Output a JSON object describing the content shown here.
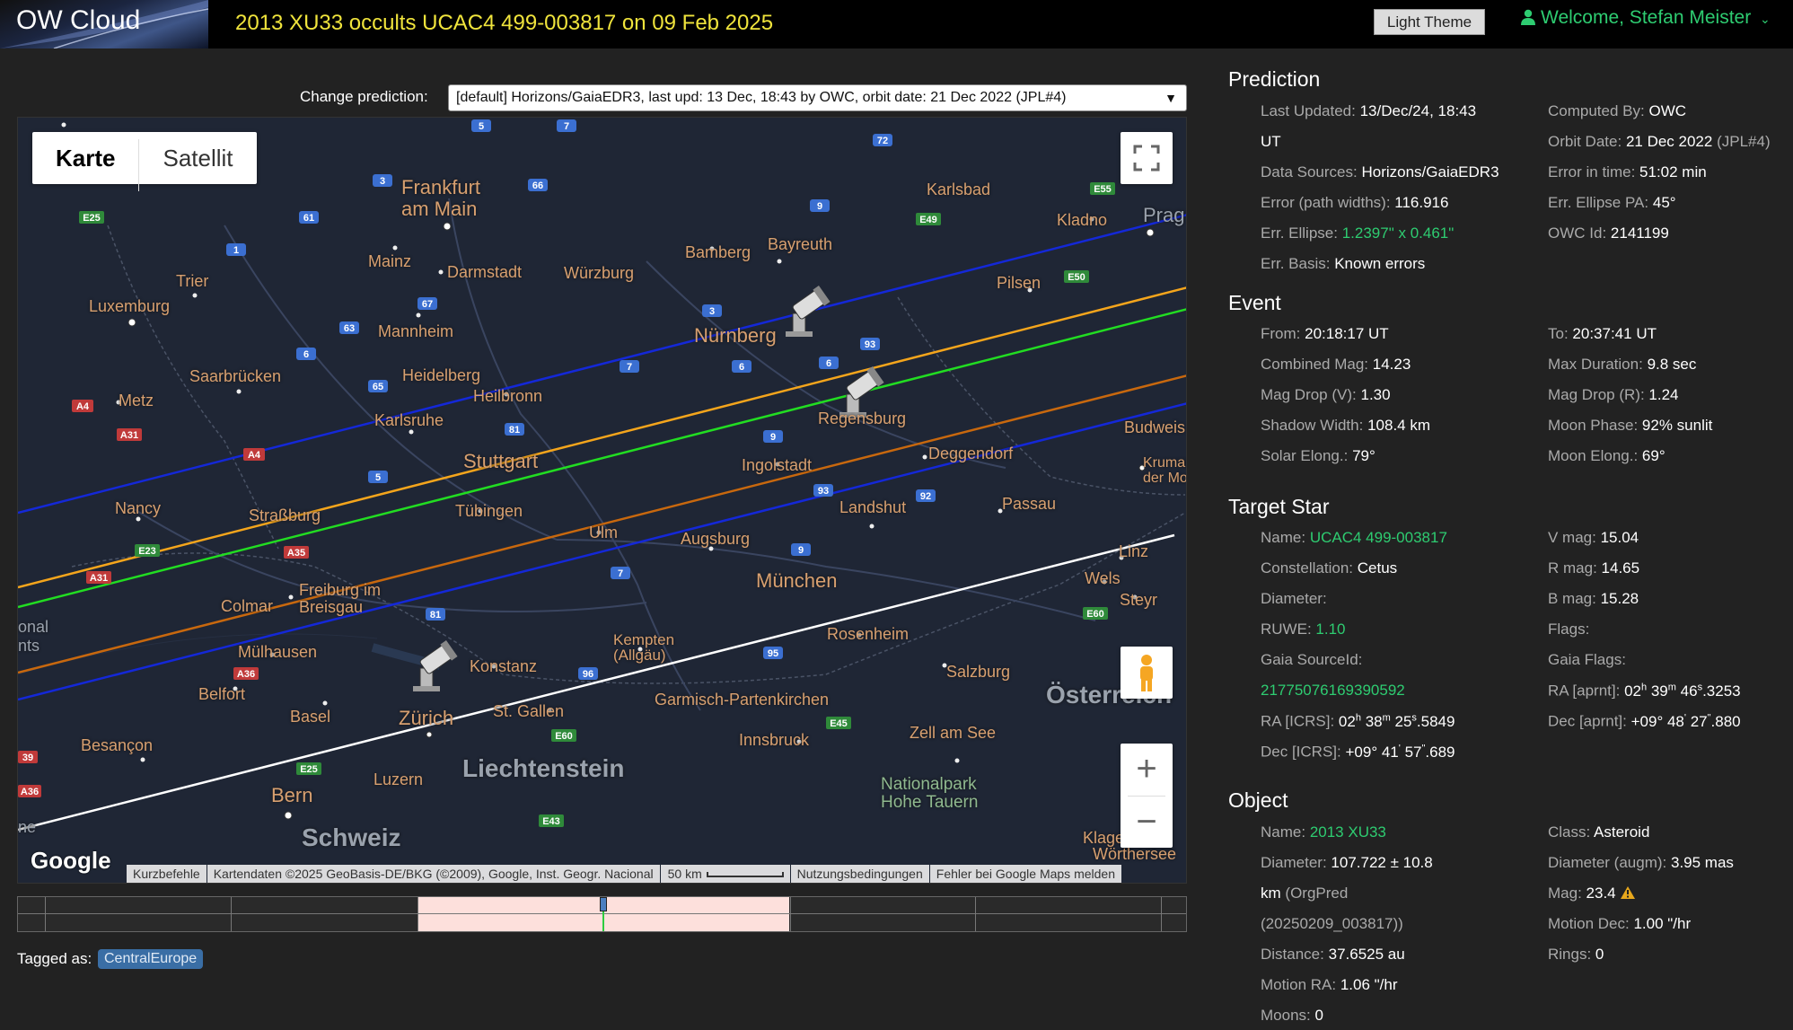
{
  "header": {
    "brand": "OW Cloud",
    "title": "2013 XU33 occults UCAC4 499-003817 on 09 Feb 2025",
    "theme_button": "Light Theme",
    "welcome": "Welcome, Stefan Meister"
  },
  "prediction_select": {
    "label": "Change prediction:",
    "value": "[default] Horizons/GaiaEDR3, last upd: 13 Dec, 18:43 by OWC, orbit date: 21 Dec 2022 (JPL#4)"
  },
  "map": {
    "type_controls": [
      "Karte",
      "Satellit"
    ],
    "active_type": "Karte",
    "logo": "Google",
    "attribution": [
      "Kurzbefehle",
      "Kartendaten ©2025 GeoBasis-DE/BKG (©2009), Google, Inst. Geogr. Nacional",
      "50 km",
      "Nutzungsbedingungen",
      "Fehler bei Google Maps melden"
    ],
    "cities": {
      "frankfurt": "Frankfurt\nam Main",
      "mainz": "Mainz",
      "darmstadt": "Darmstadt",
      "wuerzburg": "Würzburg",
      "bamberg": "Bamberg",
      "bayreuth": "Bayreuth",
      "karlsbad": "Karlsbad",
      "kladno": "Kladno",
      "prag": "Prag",
      "trier": "Trier",
      "luxemburg": "Luxemburg",
      "mannheim": "Mannheim",
      "pilsen": "Pilsen",
      "nuernberg": "Nürnberg",
      "saarbruecken": "Saarbrücken",
      "heidelberg": "Heidelberg",
      "heilbronn": "Heilbronn",
      "metz": "Metz",
      "karlsruhe": "Karlsruhe",
      "regensburg": "Regensburg",
      "budweis": "Budweis",
      "stuttgart": "Stuttgart",
      "ingolstadt": "Ingolstadt",
      "deggendorf": "Deggendorf",
      "krumau": "Krumau\nder Mo",
      "nancy": "Nancy",
      "strassburg": "Straßburg",
      "tuebingen": "Tübingen",
      "landshut": "Landshut",
      "passau": "Passau",
      "ulm": "Ulm",
      "augsburg": "Augsburg",
      "linz": "Linz",
      "colmar": "Colmar",
      "freiburg": "Freiburg im\nBreisgau",
      "muenchen": "München",
      "wels": "Wels",
      "steyr": "Steyr",
      "kempten": "Kempten\n(Allgäu)",
      "rosenheim": "Rosenheim",
      "muelhausen": "Mülhausen",
      "konstanz": "Konstanz",
      "salzburg": "Salzburg",
      "belfort": "Belfort",
      "basel": "Basel",
      "zuerich": "Zürich",
      "stgallen": "St. Gallen",
      "garmisch": "Garmisch-Partenkirchen",
      "oesterreich": "Österreich",
      "besancon": "Besançon",
      "innsbruck": "Innsbruck",
      "zellamsee": "Zell am See",
      "liechtenstein": "Liechtenstein",
      "bern": "Bern",
      "luzern": "Luzern",
      "nationalpark": "Nationalpark\nHohe Tauern",
      "schweiz": "Schweiz",
      "klagenfurt": "Klage",
      "woerthersee": "Wörthersee",
      "national": "onal",
      "nts": "nts",
      "ne": "ne"
    }
  },
  "timeline": {
    "highlight_fraction": [
      0.342,
      0.66
    ],
    "marker_fraction": 0.501
  },
  "tags": {
    "label": "Tagged as:",
    "items": [
      "CentralEurope"
    ]
  },
  "prediction": {
    "title": "Prediction",
    "last_updated_label": "Last Updated:",
    "last_updated": "13/Dec/24, 18:43",
    "last_updated_ut": "UT",
    "computed_by_label": "Computed By:",
    "computed_by": "OWC",
    "orbit_date_label": "Orbit Date:",
    "orbit_date": "21 Dec 2022",
    "orbit_ref": "(JPL#4)",
    "data_sources_label": "Data Sources:",
    "data_sources": "Horizons/GaiaEDR3",
    "error_time_label": "Error in time:",
    "error_time": "51:02 min",
    "error_path_label": "Error (path widths):",
    "error_path": "116.916",
    "ellipse_pa_label": "Err. Ellipse PA:",
    "ellipse_pa": "45°",
    "ellipse_label": "Err. Ellipse:",
    "ellipse": "1.2397\" x 0.461\"",
    "owc_id_label": "OWC Id:",
    "owc_id": "2141199",
    "basis_label": "Err. Basis:",
    "basis": "Known errors"
  },
  "event": {
    "title": "Event",
    "from_label": "From:",
    "from": "20:18:17 UT",
    "to_label": "To:",
    "to": "20:37:41 UT",
    "combined_mag_label": "Combined Mag:",
    "combined_mag": "14.23",
    "max_duration_label": "Max Duration:",
    "max_duration": "9.8 sec",
    "drop_v_label": "Mag Drop (V):",
    "drop_v": "1.30",
    "drop_r_label": "Mag Drop (R):",
    "drop_r": "1.24",
    "shadow_label": "Shadow Width:",
    "shadow": "108.4 km",
    "moon_phase_label": "Moon Phase:",
    "moon_phase": "92% sunlit",
    "solar_elong_label": "Solar Elong.:",
    "solar_elong": "79°",
    "moon_elong_label": "Moon Elong.:",
    "moon_elong": "69°"
  },
  "target_star": {
    "title": "Target Star",
    "name_label": "Name:",
    "name": "UCAC4 499-003817",
    "vmag_label": "V mag:",
    "vmag": "15.04",
    "constellation_label": "Constellation:",
    "constellation": "Cetus",
    "rmag_label": "R mag:",
    "rmag": "14.65",
    "diameter_label": "Diameter:",
    "bmag_label": "B mag:",
    "bmag": "15.28",
    "ruwe_label": "RUWE:",
    "ruwe": "1.10",
    "flags_label": "Flags:",
    "source_id_label": "Gaia SourceId:",
    "source_id": "21775076169390592",
    "gaia_flags_label": "Gaia Flags:",
    "ra_aprnt_label": "RA [aprnt]:",
    "ra_aprnt": [
      "02",
      "h",
      " 39",
      "m",
      " 46",
      "s",
      ".3253"
    ],
    "ra_icrs_label": "RA [ICRS]:",
    "ra_icrs": [
      "02",
      "h",
      " 38",
      "m",
      " 25",
      "s",
      ".5849"
    ],
    "dec_aprnt_label": "Dec [aprnt]:",
    "dec_aprnt": [
      "+09° 48",
      "'",
      " 27",
      "\"",
      ".880"
    ],
    "dec_icrs_label": "Dec [ICRS]:",
    "dec_icrs": [
      "+09° 41",
      "'",
      " 57",
      "\"",
      ".689"
    ]
  },
  "object": {
    "title": "Object",
    "name_label": "Name:",
    "name": "2013 XU33",
    "class_label": "Class:",
    "class": "Asteroid",
    "diameter_label": "Diameter:",
    "diameter": "107.722 ± 10.8",
    "diameter_unit": "km",
    "diameter_src": "(OrgPred",
    "diameter_src2": "(20250209_003817))",
    "diam_augm_label": "Diameter (augm):",
    "diam_augm": "3.95 mas",
    "mag_label": "Mag:",
    "mag": "23.4",
    "distance_label": "Distance:",
    "distance": "37.6525 au",
    "motion_dec_label": "Motion Dec:",
    "motion_dec": "1.00 \"/hr",
    "motion_ra_label": "Motion RA:",
    "motion_ra": "1.06 \"/hr",
    "rings_label": "Rings:",
    "rings": "0",
    "moons_label": "Moons:",
    "moons": "0"
  },
  "colors": {
    "accent_green": "#2ecc71",
    "title_yellow": "#f0e43c",
    "line_blue": "#1428d8",
    "line_orange": "#f4a51c",
    "line_green": "#22dd22",
    "line_brown": "#c8680e",
    "line_white": "#ffffff"
  }
}
